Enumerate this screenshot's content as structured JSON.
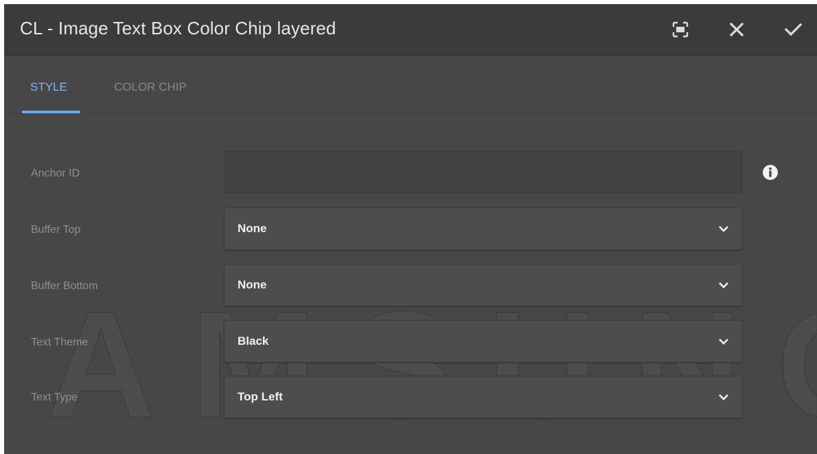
{
  "dialog": {
    "title": "CL - Image Text Box Color Chip layered",
    "actions": [
      {
        "name": "fullscreen-icon"
      },
      {
        "name": "close-icon"
      },
      {
        "name": "checkmark-icon"
      }
    ]
  },
  "tabs": [
    {
      "label": "STYLE",
      "active": true
    },
    {
      "label": "COLOR CHIP",
      "active": false
    }
  ],
  "fields": {
    "anchor_id": {
      "label": "Anchor ID",
      "value": "",
      "info_icon": "info-icon"
    },
    "buffer_top": {
      "label": "Buffer Top",
      "value": "None"
    },
    "buffer_bottom": {
      "label": "Buffer Bottom",
      "value": "None"
    },
    "text_theme": {
      "label": "Text Theme",
      "value": "Black"
    },
    "text_type": {
      "label": "Text Type",
      "value": "Top Left"
    }
  },
  "watermark": {
    "text": "SAMSUNG"
  },
  "colors": {
    "accent": "#6ba8ee",
    "dialog_bg": "#474747",
    "titlebar_bg": "#3b3b3b"
  }
}
